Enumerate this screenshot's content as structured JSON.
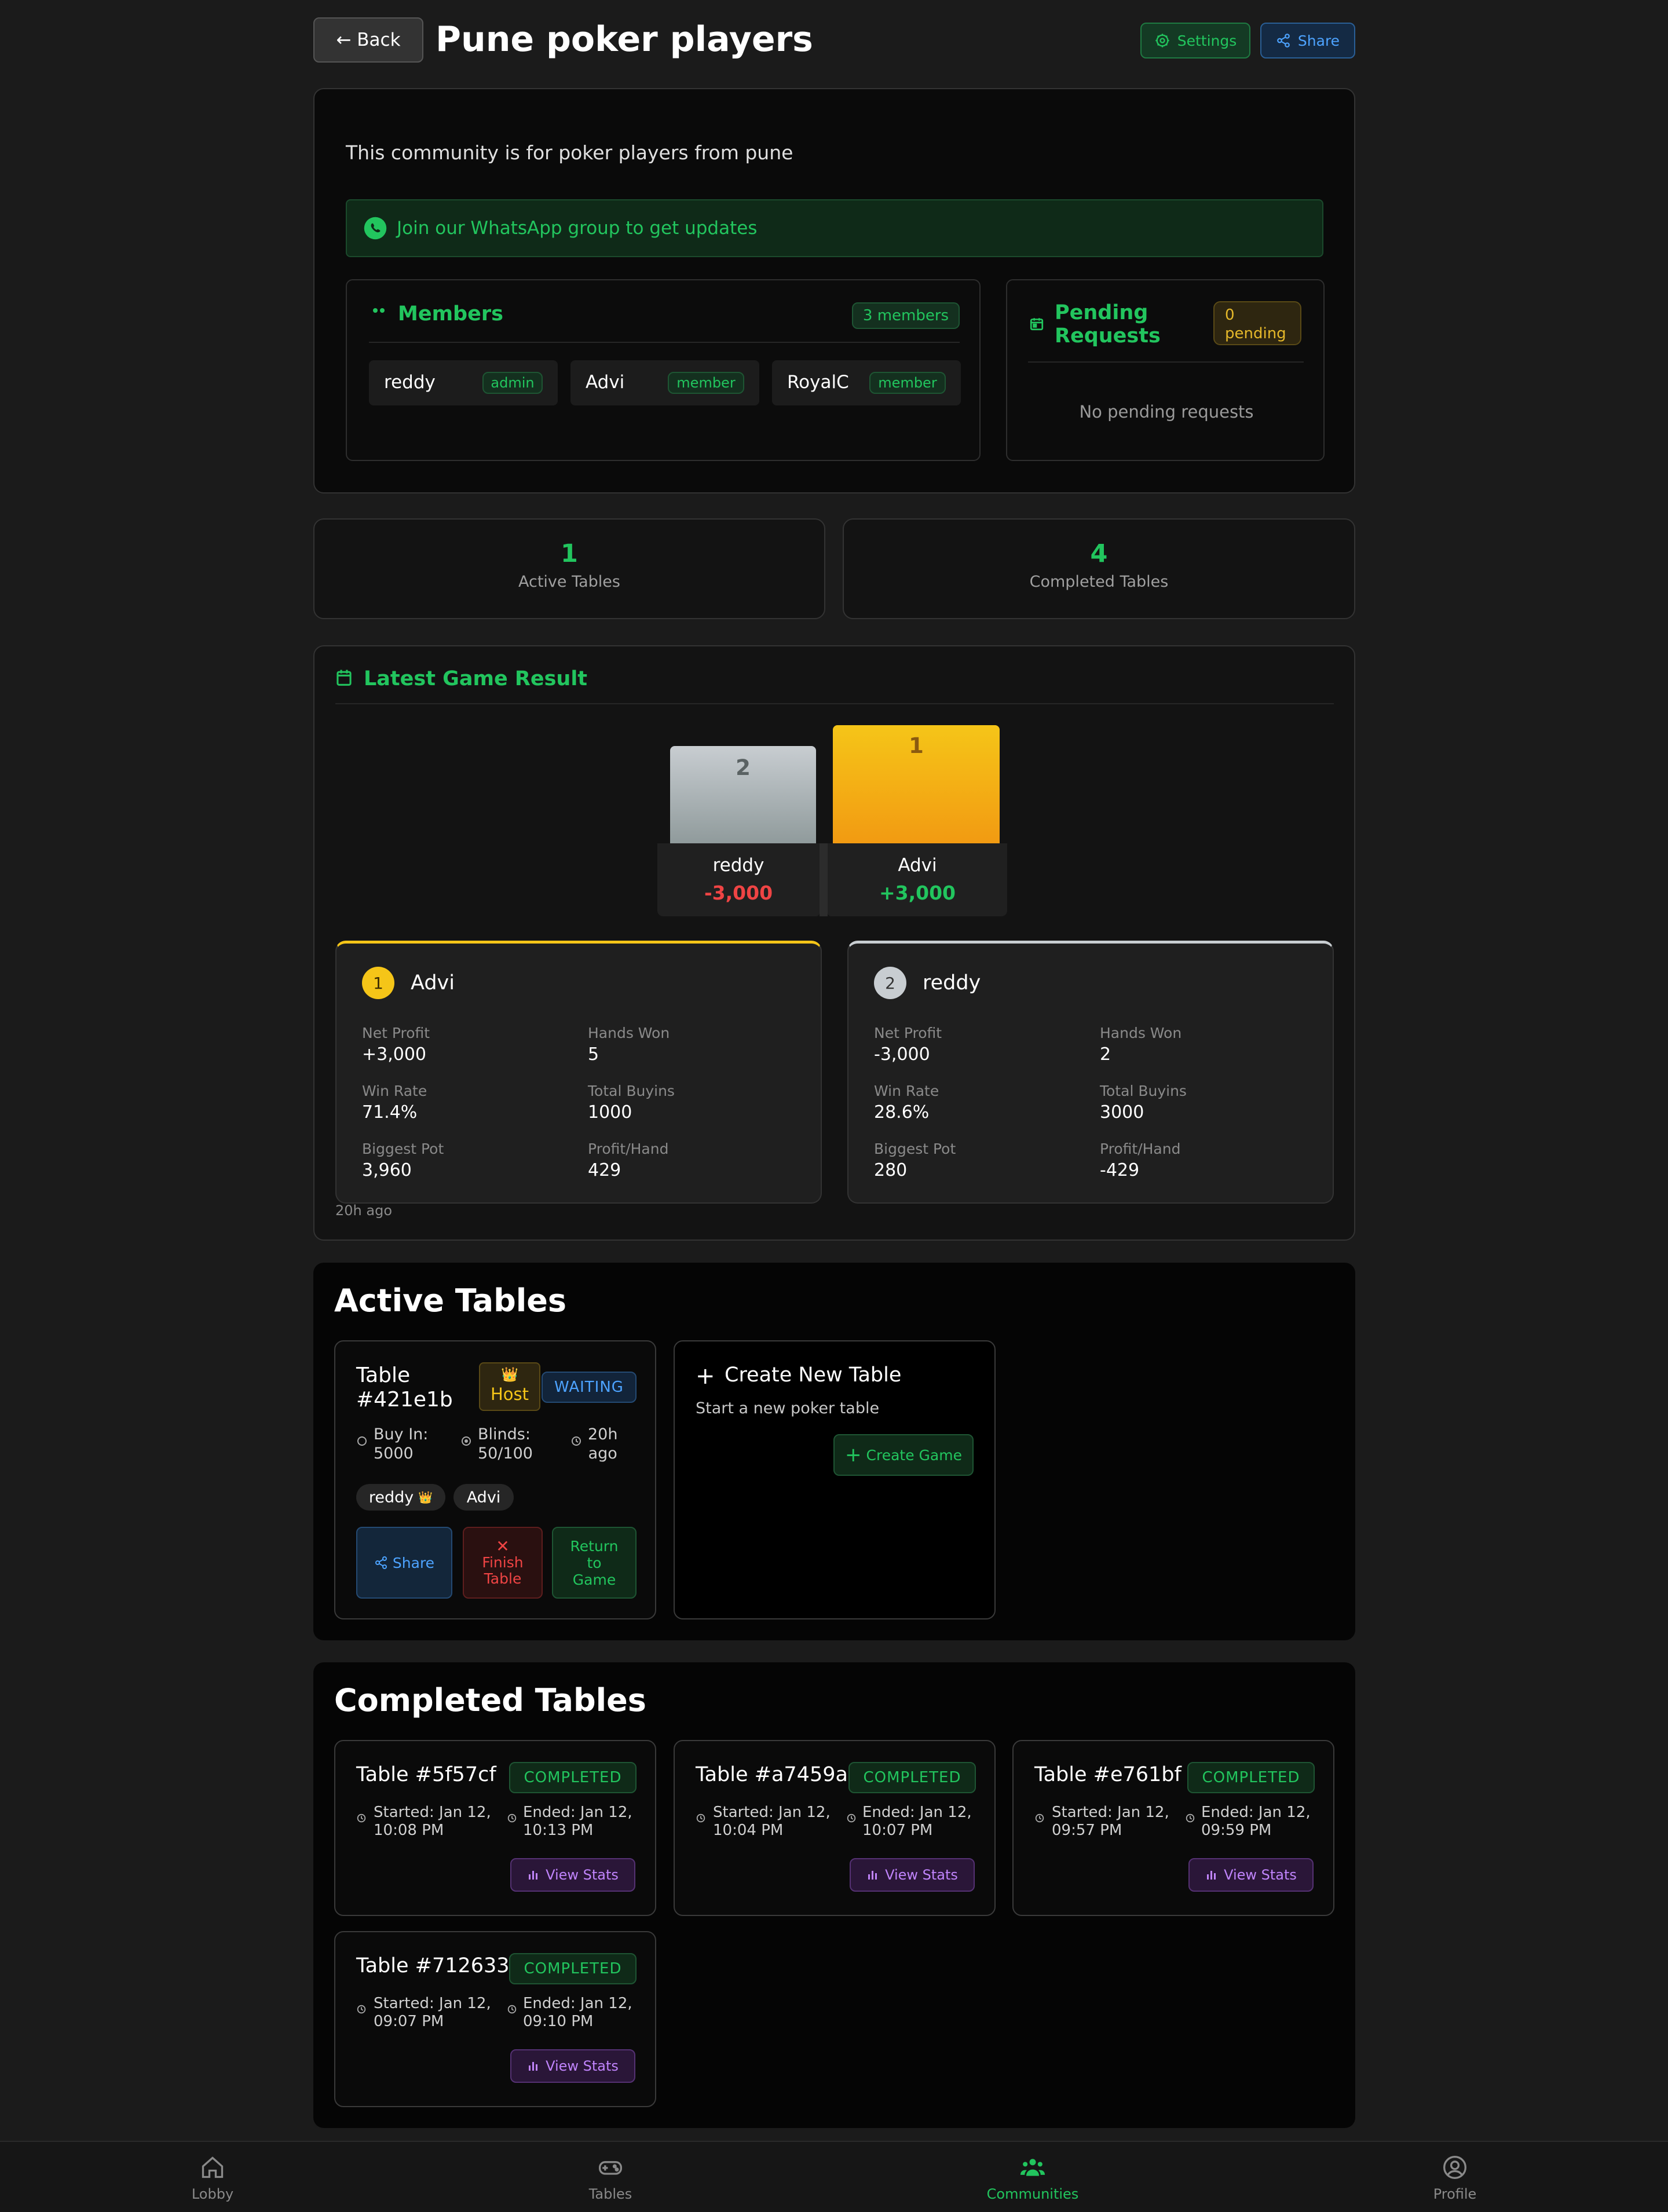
{
  "header": {
    "back_label": "← Back",
    "title": "Pune poker players",
    "settings_label": "Settings",
    "share_label": "Share"
  },
  "community": {
    "description": "This community is for poker players from pune",
    "whatsapp_text": "Join our WhatsApp group to get updates",
    "members": {
      "title": "Members",
      "count_badge": "3 members",
      "list": [
        {
          "name": "reddy",
          "role": "admin"
        },
        {
          "name": "Advi",
          "role": "member"
        },
        {
          "name": "RoyalC",
          "role": "member"
        }
      ]
    },
    "pending": {
      "title_line1": "Pending",
      "title_line2": "Requests",
      "badge_line1": "0",
      "badge_line2": "pending",
      "empty_text": "No pending requests"
    }
  },
  "stats": {
    "active_count": "1",
    "active_label": "Active Tables",
    "completed_count": "4",
    "completed_label": "Completed Tables"
  },
  "latest": {
    "title": "Latest Game Result",
    "podium": [
      {
        "rank": "2",
        "name": "reddy",
        "profit": "-3,000"
      },
      {
        "rank": "1",
        "name": "Advi",
        "profit": "+3,000"
      }
    ],
    "players": [
      {
        "rank": "1",
        "name": "Advi",
        "net_profit_label": "Net Profit",
        "net_profit": "+3,000",
        "hands_won_label": "Hands Won",
        "hands_won": "5",
        "win_rate_label": "Win Rate",
        "win_rate": "71.4%",
        "total_buyins_label": "Total Buyins",
        "total_buyins": "1000",
        "biggest_pot_label": "Biggest Pot",
        "biggest_pot": "3,960",
        "profit_hand_label": "Profit/Hand",
        "profit_hand": "429"
      },
      {
        "rank": "2",
        "name": "reddy",
        "net_profit_label": "Net Profit",
        "net_profit": "-3,000",
        "hands_won_label": "Hands Won",
        "hands_won": "2",
        "win_rate_label": "Win Rate",
        "win_rate": "28.6%",
        "total_buyins_label": "Total Buyins",
        "total_buyins": "3000",
        "biggest_pot_label": "Biggest Pot",
        "biggest_pot": "280",
        "profit_hand_label": "Profit/Hand",
        "profit_hand": "-429"
      }
    ],
    "time_ago": "20h ago"
  },
  "active_tables": {
    "title": "Active Tables",
    "table": {
      "name_line1": "Table",
      "name_line2": "#421e1b",
      "host_label": "Host",
      "status": "WAITING",
      "buyin_line1": "Buy In:",
      "buyin_line2": "5000",
      "blinds_line1": "Blinds:",
      "blinds_line2": "50/100",
      "time_line1": "20h",
      "time_line2": "ago",
      "players": [
        "reddy",
        "Advi"
      ],
      "share_label": "Share",
      "finish_line1": "Finish",
      "finish_line2": "Table",
      "return_line1": "Return",
      "return_line2": "to",
      "return_line3": "Game"
    },
    "create": {
      "title": "Create New Table",
      "subtitle": "Start a new poker table",
      "button_label": "Create Game"
    }
  },
  "completed_tables": {
    "title": "Completed Tables",
    "status_label": "COMPLETED",
    "stats_label": "View Stats",
    "items": [
      {
        "name": "Table #5f57cf",
        "started_1": "Started: Jan 12,",
        "started_2": "10:08 PM",
        "ended_1": "Ended: Jan 12,",
        "ended_2": "10:13 PM"
      },
      {
        "name": "Table #a7459a",
        "started_1": "Started: Jan 12,",
        "started_2": "10:04 PM",
        "ended_1": "Ended: Jan 12,",
        "ended_2": "10:07 PM"
      },
      {
        "name": "Table #e761bf",
        "started_1": "Started: Jan 12,",
        "started_2": "09:57 PM",
        "ended_1": "Ended: Jan 12,",
        "ended_2": "09:59 PM"
      },
      {
        "name": "Table #712633",
        "started_1": "Started: Jan 12,",
        "started_2": "09:07 PM",
        "ended_1": "Ended: Jan 12,",
        "ended_2": "09:10 PM"
      }
    ]
  },
  "nav": {
    "items": [
      {
        "label": "Lobby",
        "icon": "home-icon"
      },
      {
        "label": "Tables",
        "icon": "gamepad-icon"
      },
      {
        "label": "Communities",
        "icon": "users-icon",
        "active": true
      },
      {
        "label": "Profile",
        "icon": "user-circle-icon"
      }
    ]
  },
  "colors": {
    "accent_green": "#22c55e",
    "loss_red": "#ef4444",
    "gold": "#f5c518",
    "share_blue": "#4da3ff",
    "stats_purple": "#c084fc"
  }
}
